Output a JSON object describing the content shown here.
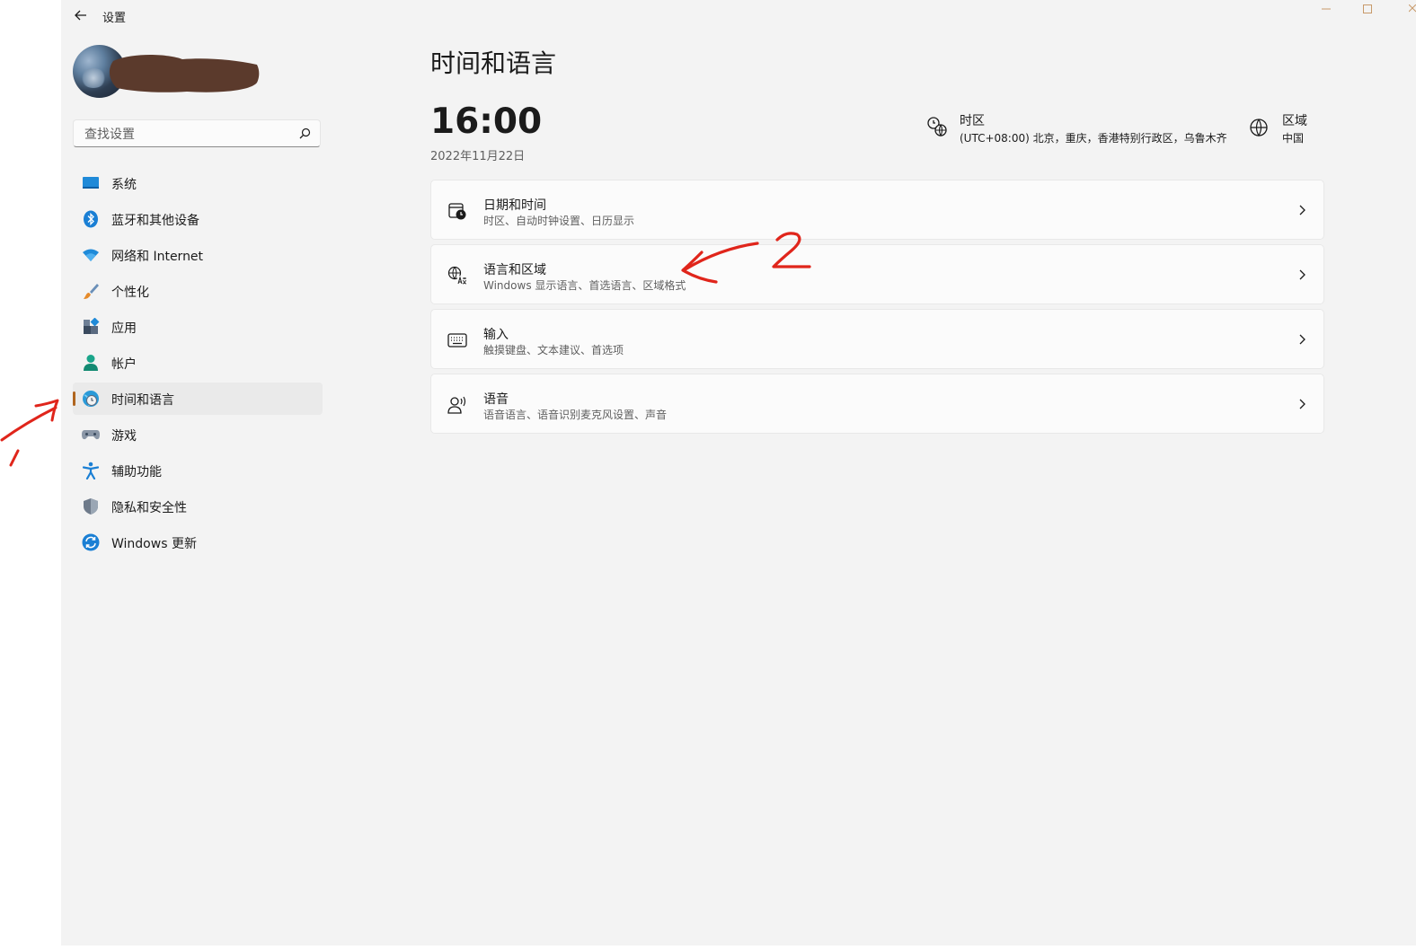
{
  "app": {
    "title": "设置"
  },
  "search": {
    "placeholder": "查找设置"
  },
  "nav": {
    "items": [
      {
        "label": "系统",
        "icon": "monitor-icon"
      },
      {
        "label": "蓝牙和其他设备",
        "icon": "bluetooth-icon"
      },
      {
        "label": "网络和 Internet",
        "icon": "wifi-icon"
      },
      {
        "label": "个性化",
        "icon": "brush-icon"
      },
      {
        "label": "应用",
        "icon": "apps-icon"
      },
      {
        "label": "帐户",
        "icon": "person-icon"
      },
      {
        "label": "时间和语言",
        "icon": "globe-clock-icon",
        "selected": true
      },
      {
        "label": "游戏",
        "icon": "gamepad-icon"
      },
      {
        "label": "辅助功能",
        "icon": "accessibility-icon"
      },
      {
        "label": "隐私和安全性",
        "icon": "shield-icon"
      },
      {
        "label": "Windows 更新",
        "icon": "update-icon"
      }
    ]
  },
  "main": {
    "title": "时间和语言",
    "clock": "16:00",
    "date": "2022年11月22日",
    "timezone": {
      "label": "时区",
      "value": "(UTC+08:00) 北京，重庆，香港特别行政区，乌鲁木齐"
    },
    "region": {
      "label": "区域",
      "value": "中国"
    },
    "cards": [
      {
        "title": "日期和时间",
        "subtitle": "时区、自动时钟设置、日历显示",
        "icon": "calendar-clock-icon"
      },
      {
        "title": "语言和区域",
        "subtitle": "Windows 显示语言、首选语言、区域格式",
        "icon": "language-icon"
      },
      {
        "title": "输入",
        "subtitle": "触摸键盘、文本建议、首选项",
        "icon": "keyboard-icon"
      },
      {
        "title": "语音",
        "subtitle": "语音语言、语音识别麦克风设置、声音",
        "icon": "speech-icon"
      }
    ]
  },
  "annotations": [
    "1",
    "2"
  ],
  "colors": {
    "accent": "#b0651f",
    "window_bg": "#f3f3f3",
    "card_bg": "#fbfbfb",
    "annotation": "#e0251b"
  }
}
